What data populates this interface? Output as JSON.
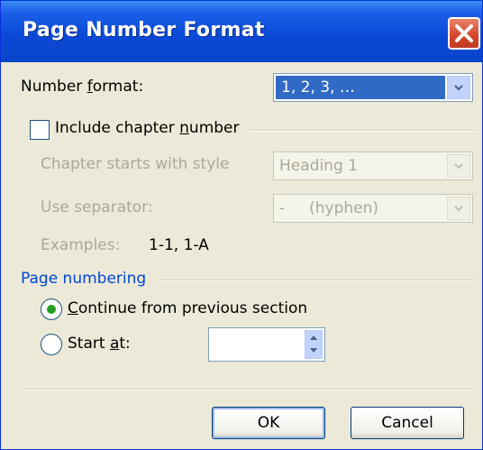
{
  "dialog": {
    "title": "Page Number Format"
  },
  "number_format": {
    "label_pre": "Number ",
    "label_accel": "f",
    "label_post": "ormat:",
    "value": "1, 2, 3, …"
  },
  "chapter": {
    "include_pre": "Include chapter ",
    "include_accel": "n",
    "include_post": "umber",
    "include_checked": false,
    "starts_label": "Chapter starts with style",
    "starts_value": "Heading 1",
    "separator_label": "Use separator:",
    "separator_value": "-     (hyphen)",
    "examples_label": "Examples:",
    "examples_value": "1-1, 1-A"
  },
  "page_numbering": {
    "section_title": "Page numbering",
    "continue_accel": "C",
    "continue_post": "ontinue from previous section",
    "continue_selected": true,
    "start_pre": "Start ",
    "start_accel": "a",
    "start_post": "t:",
    "start_value": ""
  },
  "buttons": {
    "ok": "OK",
    "cancel": "Cancel"
  },
  "colors": {
    "title_bar": "#0a48d6",
    "close_button": "#d3442a",
    "section_title": "#0046d5",
    "selection_highlight": "#316ac5"
  }
}
